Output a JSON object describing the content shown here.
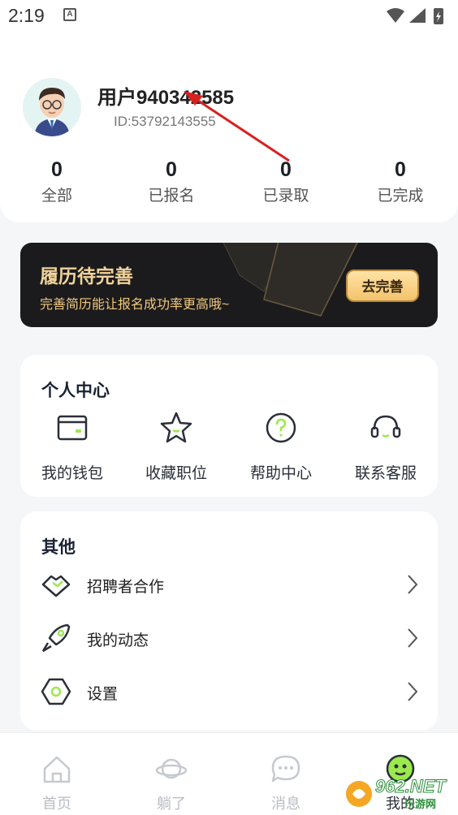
{
  "status_bar": {
    "time": "2:19",
    "notification": "A"
  },
  "profile": {
    "username": "用户940342585",
    "user_id": "ID:53792143555",
    "stats": [
      {
        "count": "0",
        "label": "全部"
      },
      {
        "count": "0",
        "label": "已报名"
      },
      {
        "count": "0",
        "label": "已录取"
      },
      {
        "count": "0",
        "label": "已完成"
      }
    ]
  },
  "banner": {
    "title": "履历待完善",
    "subtitle": "完善简历能让报名成功率更高哦~",
    "button": "去完善"
  },
  "personal_center": {
    "title": "个人中心",
    "items": [
      {
        "label": "我的钱包",
        "icon": "wallet-icon"
      },
      {
        "label": "收藏职位",
        "icon": "star-icon"
      },
      {
        "label": "帮助中心",
        "icon": "help-icon"
      },
      {
        "label": "联系客服",
        "icon": "headset-icon"
      }
    ]
  },
  "other": {
    "title": "其他",
    "items": [
      {
        "label": "招聘者合作",
        "icon": "handshake-icon"
      },
      {
        "label": "我的动态",
        "icon": "rocket-icon"
      },
      {
        "label": "设置",
        "icon": "settings-icon"
      }
    ]
  },
  "tab_bar": {
    "items": [
      {
        "label": "首页",
        "icon": "home-icon"
      },
      {
        "label": "躺了",
        "icon": "planet-icon"
      },
      {
        "label": "消息",
        "icon": "chat-icon"
      },
      {
        "label": "我的",
        "icon": "face-icon",
        "active": true
      }
    ]
  },
  "watermark": {
    "text": "962.NET",
    "sub": "乐游网"
  },
  "colors": {
    "accent": "#9be94c",
    "banner_gold": "#f1d39a"
  }
}
